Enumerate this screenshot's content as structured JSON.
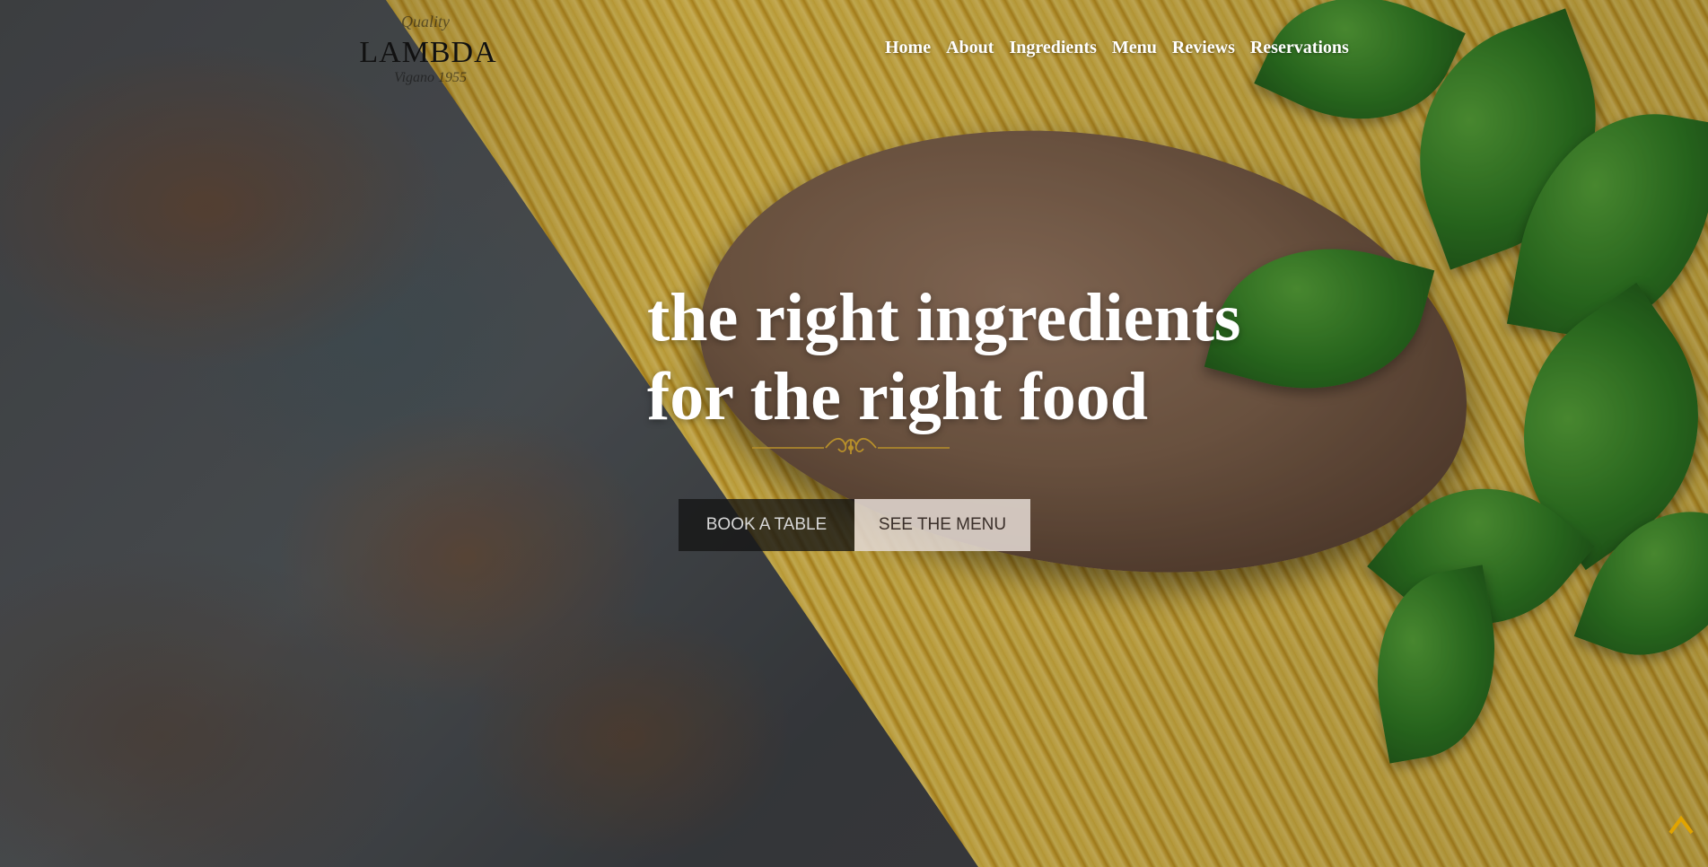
{
  "brand": {
    "top": "Quality",
    "name": "LAMBDA",
    "bottom": "Vigano 1955"
  },
  "nav": {
    "items": [
      {
        "label": "Home"
      },
      {
        "label": "About"
      },
      {
        "label": "Ingredients"
      },
      {
        "label": "Menu"
      },
      {
        "label": "Reviews"
      },
      {
        "label": "Reservations"
      }
    ]
  },
  "hero": {
    "headline_line1": "the right ingredients",
    "headline_line2": "for the right food",
    "ornament_icon": "flourish-divider-icon",
    "buttons": {
      "book_label": "BOOK A TABLE",
      "menu_label": "SEE THE MENU"
    }
  },
  "widgets": {
    "scroll_top_icon": "chevron-up-icon"
  },
  "colors": {
    "ornament_gold": "#b8902a",
    "scroll_accent": "#e0a400"
  }
}
